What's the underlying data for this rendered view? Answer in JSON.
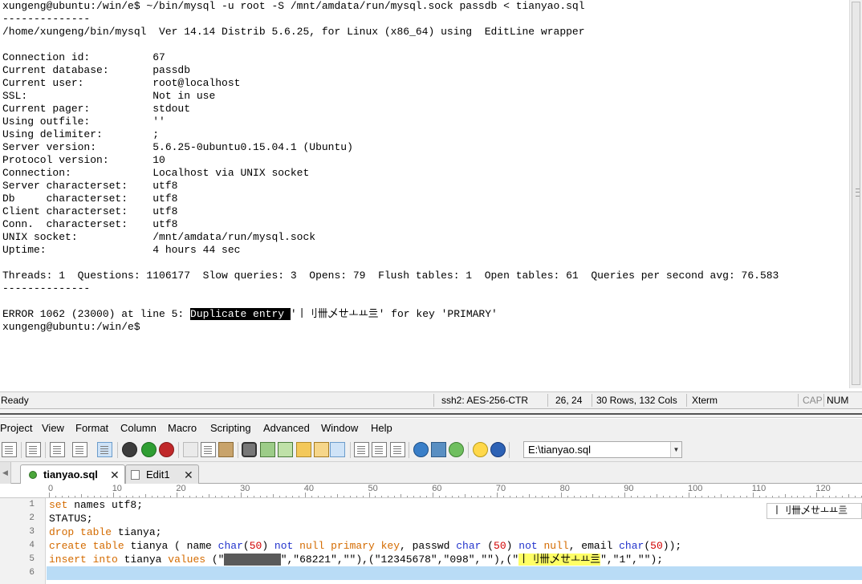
{
  "terminal": {
    "lines": [
      "xungeng@ubuntu:/win/e$ ~/bin/mysql -u root -S /mnt/amdata/run/mysql.sock passdb < tianyao.sql",
      "--------------",
      "/home/xungeng/bin/mysql  Ver 14.14 Distrib 5.6.25, for Linux (x86_64) using  EditLine wrapper",
      "",
      "Connection id:          67",
      "Current database:       passdb",
      "Current user:           root@localhost",
      "SSL:                    Not in use",
      "Current pager:          stdout",
      "Using outfile:          ''",
      "Using delimiter:        ;",
      "Server version:         5.6.25-0ubuntu0.15.04.1 (Ubuntu)",
      "Protocol version:       10",
      "Connection:             Localhost via UNIX socket",
      "Server characterset:    utf8",
      "Db     characterset:    utf8",
      "Client characterset:    utf8",
      "Conn.  characterset:    utf8",
      "UNIX socket:            /mnt/amdata/run/mysql.sock",
      "Uptime:                 4 hours 44 sec",
      "",
      "Threads: 1  Questions: 1106177  Slow queries: 3  Opens: 79  Flush tables: 1  Open tables: 61  Queries per second avg: 76.583",
      "--------------",
      ""
    ],
    "error_prefix": "ERROR 1062 (23000) at line 5: ",
    "error_selected": "Duplicate entry ",
    "error_suffix": "'丨刂卌乄ㄝㅗㅛ亖' for key 'PRIMARY'",
    "prompt": "xungeng@ubuntu:/win/e$"
  },
  "statusbar": {
    "ready": "Ready",
    "cipher": "ssh2: AES-256-CTR",
    "position": "26,  24",
    "size": "30 Rows, 132 Cols",
    "emulation": "Xterm",
    "cap": "CAP",
    "num": "NUM"
  },
  "menu": [
    "Project",
    "View",
    "Format",
    "Column",
    "Macro",
    "Scripting",
    "Advanced",
    "Window",
    "Help"
  ],
  "toolbar": {
    "path": "E:\\tianyao.sql",
    "icons": [
      "print-preview-icon",
      "word-wrap-icon",
      "spellcheck-icon",
      "document-view-icon",
      "back-icon",
      "forward-icon",
      "stop-icon",
      "cut-icon",
      "copy-icon",
      "paste-icon",
      "find-icon",
      "find-next-icon",
      "replace-icon",
      "goto-icon",
      "bookmark-icon",
      "toggle-list-icon",
      "column-mode-icon",
      "split-window-icon",
      "web-browser-icon",
      "preview-icon",
      "refresh-icon",
      "tip-icon",
      "help-icon"
    ]
  },
  "tabs": [
    {
      "label": "tianyao.sql",
      "active": true
    },
    {
      "label": "Edit1",
      "active": false
    }
  ],
  "ruler": [
    "0",
    "10",
    "20",
    "30",
    "40",
    "50",
    "60",
    "70",
    "80",
    "90",
    "100",
    "110",
    "120"
  ],
  "editor": {
    "line_numbers": [
      "1",
      "2",
      "3",
      "4",
      "5",
      "6"
    ],
    "line1": {
      "a": "set",
      "b": " names utf8;"
    },
    "line2": {
      "a": "STATUS;"
    },
    "line3": {
      "a": "drop",
      "b": " ",
      "c": "table",
      "d": " tianya;"
    },
    "line4": {
      "a": "create",
      "b": " ",
      "c": "table",
      "d": " tianya ( name ",
      "e": "char",
      "f": "(",
      "g": "50",
      "h": ") ",
      "i": "not",
      "j": " ",
      "k": "null",
      "l": " ",
      "m": "primary",
      "n": " ",
      "o": "key",
      "p": ", passwd ",
      "q": "char",
      "r": " (",
      "s": "50",
      "t": ") ",
      "u": "not",
      "v": " ",
      "w": "null",
      "x": ", email ",
      "y": "char",
      "z": "(",
      "aa": "50",
      "ab": "));"
    },
    "line5": {
      "a": "insert",
      "b": " ",
      "c": "into",
      "d": " tianya ",
      "e": "values",
      "f": " (\"",
      "g": "█████████",
      "h": "\",\"68221\",\"\"),(\"12345678\",\"098\",\"\"),(\"",
      "i": "丨刂卌乄ㄝㅗㅛ亖",
      "j": "\",\"1\",\"\");"
    },
    "tooltip": "丨刂卌乄ㄝㅗㅛ亖"
  },
  "colors": {
    "keyword": "#d46b00",
    "type_keyword": "#2233cc",
    "number": "#d10000",
    "highlight": "#ffff66",
    "current_line": "#b9dcf6"
  }
}
